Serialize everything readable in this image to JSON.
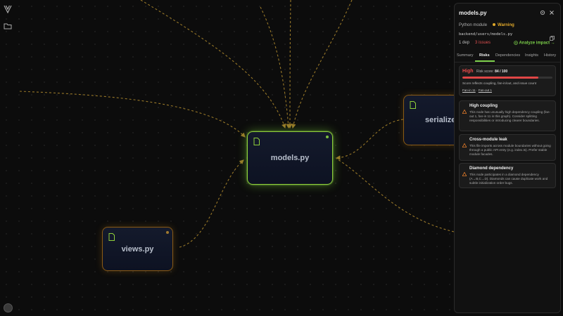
{
  "graph": {
    "nodes": [
      {
        "id": "models",
        "label": "models.py",
        "state": "focused"
      },
      {
        "id": "views",
        "label": "views.py",
        "state": "normal"
      },
      {
        "id": "serializers",
        "label": "serializers",
        "state": "normal"
      }
    ]
  },
  "panel": {
    "title": "models.py",
    "subtitle": "Python module",
    "status": "Warning",
    "path": "backend/users/models.py",
    "deps": "1 dep",
    "issues": "3 issues",
    "analyze_label": "Analyze impact →",
    "tabs": [
      "Summary",
      "Risks",
      "Dependencies",
      "Insights",
      "History"
    ],
    "active_tab": "Risks",
    "risk": {
      "level": "High",
      "score_label": "Risk score:",
      "score_value": "84 / 100",
      "score_fraction": 0.84,
      "note": "Score reflects coupling, fan-in/out, and issue count",
      "link1": "Fan-in 11",
      "separator": "·",
      "link2": "Fan-out 1"
    },
    "issues_list": [
      {
        "title": "High coupling",
        "desc": "This node has unusually high dependency coupling (fan-out 1, fan-in 11 in this graph). Consider splitting responsibilities or introducing clearer boundaries."
      },
      {
        "title": "Cross-module leak",
        "desc": "This file imports across module boundaries without going through a public API entry (e.g. index.ts). Prefer stable module facades."
      },
      {
        "title": "Diamond dependency",
        "desc": "This node participates in a diamond dependency (A→B,C→D). Diamonds can cause duplicate work and subtle initialization order bugs."
      }
    ]
  },
  "colors": {
    "accent_green": "#7cd04a",
    "warning": "#e0a82a",
    "danger": "#e04646",
    "edge": "#a8842c"
  },
  "icons": {
    "rail": [
      "logo-icon",
      "folder-icon",
      "avatar"
    ],
    "panel": [
      "settings-icon",
      "close-icon",
      "copy-icon",
      "warning-icon"
    ]
  }
}
